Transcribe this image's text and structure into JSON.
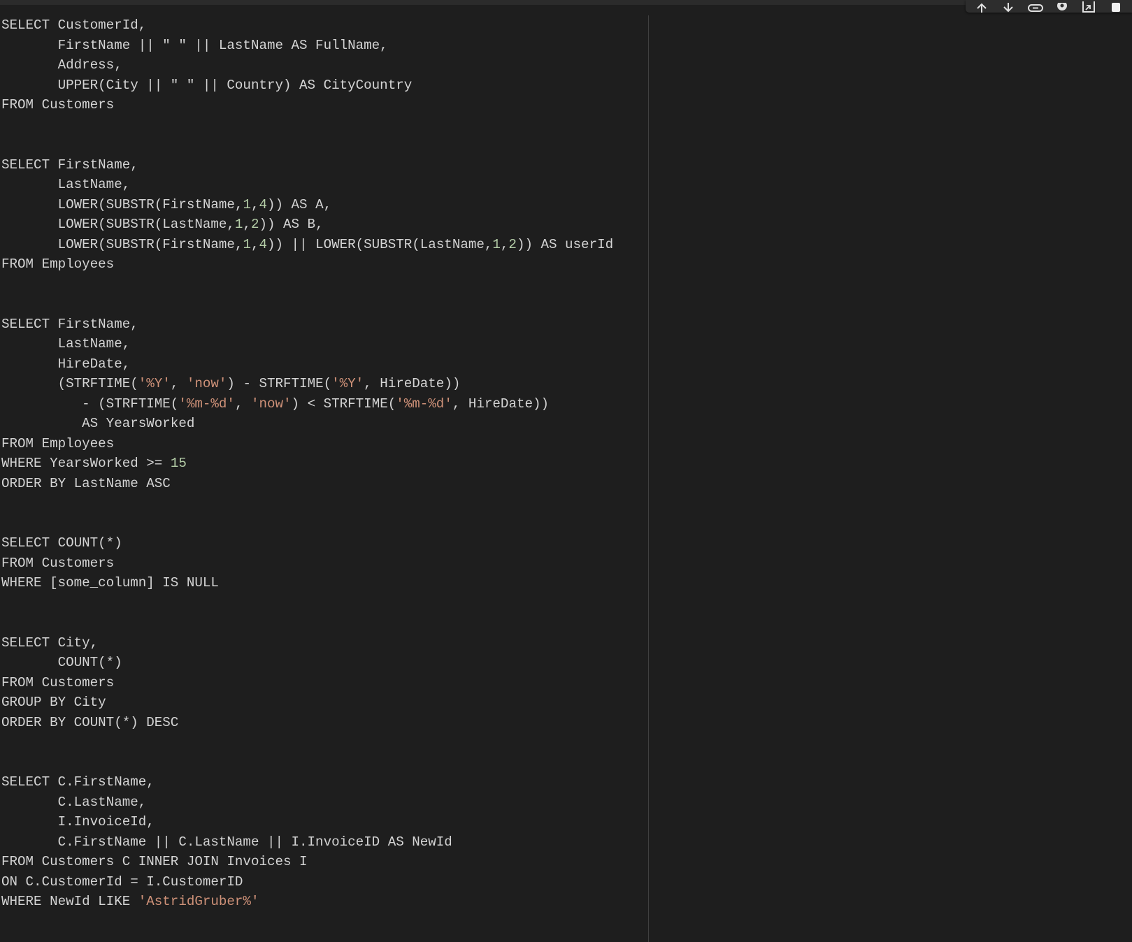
{
  "toolbar": {
    "icons": [
      "arrow-up-icon",
      "arrow-down-icon",
      "link-icon",
      "gear-icon",
      "open-external-icon",
      "trash-icon"
    ]
  },
  "colors": {
    "background": "#1e1e1e",
    "text": "#d4d4d4",
    "string": "#ce9178",
    "number": "#b5cea8"
  },
  "code": {
    "lines": [
      [
        [
          "SELECT CustomerId,",
          "t"
        ]
      ],
      [
        [
          "       FirstName || \" \" || LastName AS FullName,",
          "t"
        ]
      ],
      [
        [
          "       Address,",
          "t"
        ]
      ],
      [
        [
          "       UPPER(City || \" \" || Country) AS CityCountry",
          "t"
        ]
      ],
      [
        [
          "FROM Customers",
          "t"
        ]
      ],
      [],
      [],
      [
        [
          "SELECT FirstName,",
          "t"
        ]
      ],
      [
        [
          "       LastName,",
          "t"
        ]
      ],
      [
        [
          "       LOWER(SUBSTR(FirstName,",
          "t"
        ],
        [
          "1",
          "n"
        ],
        [
          ",",
          "t"
        ],
        [
          "4",
          "n"
        ],
        [
          ")) AS A,",
          "t"
        ]
      ],
      [
        [
          "       LOWER(SUBSTR(LastName,",
          "t"
        ],
        [
          "1",
          "n"
        ],
        [
          ",",
          "t"
        ],
        [
          "2",
          "n"
        ],
        [
          ")) AS B,",
          "t"
        ]
      ],
      [
        [
          "       LOWER(SUBSTR(FirstName,",
          "t"
        ],
        [
          "1",
          "n"
        ],
        [
          ",",
          "t"
        ],
        [
          "4",
          "n"
        ],
        [
          ")) || LOWER(SUBSTR(LastName,",
          "t"
        ],
        [
          "1",
          "n"
        ],
        [
          ",",
          "t"
        ],
        [
          "2",
          "n"
        ],
        [
          ")) AS userId",
          "t"
        ]
      ],
      [
        [
          "FROM Employees",
          "t"
        ]
      ],
      [],
      [],
      [
        [
          "SELECT FirstName,",
          "t"
        ]
      ],
      [
        [
          "       LastName,",
          "t"
        ]
      ],
      [
        [
          "       HireDate,",
          "t"
        ]
      ],
      [
        [
          "       (STRFTIME(",
          "t"
        ],
        [
          "'%Y'",
          "s"
        ],
        [
          ", ",
          "t"
        ],
        [
          "'now'",
          "s"
        ],
        [
          ") - STRFTIME(",
          "t"
        ],
        [
          "'%Y'",
          "s"
        ],
        [
          ", HireDate))",
          "t"
        ]
      ],
      [
        [
          "          - (STRFTIME(",
          "t"
        ],
        [
          "'%m-%d'",
          "s"
        ],
        [
          ", ",
          "t"
        ],
        [
          "'now'",
          "s"
        ],
        [
          ") < STRFTIME(",
          "t"
        ],
        [
          "'%m-%d'",
          "s"
        ],
        [
          ", HireDate))",
          "t"
        ]
      ],
      [
        [
          "          AS YearsWorked",
          "t"
        ]
      ],
      [
        [
          "FROM Employees",
          "t"
        ]
      ],
      [
        [
          "WHERE YearsWorked >= ",
          "t"
        ],
        [
          "15",
          "n"
        ]
      ],
      [
        [
          "ORDER BY LastName ASC",
          "t"
        ]
      ],
      [],
      [],
      [
        [
          "SELECT COUNT(*)",
          "t"
        ]
      ],
      [
        [
          "FROM Customers",
          "t"
        ]
      ],
      [
        [
          "WHERE [some_column] IS NULL",
          "t"
        ]
      ],
      [],
      [],
      [
        [
          "SELECT City,",
          "t"
        ]
      ],
      [
        [
          "       COUNT(*)",
          "t"
        ]
      ],
      [
        [
          "FROM Customers",
          "t"
        ]
      ],
      [
        [
          "GROUP BY City",
          "t"
        ]
      ],
      [
        [
          "ORDER BY COUNT(*) DESC",
          "t"
        ]
      ],
      [],
      [],
      [
        [
          "SELECT C.FirstName,",
          "t"
        ]
      ],
      [
        [
          "       C.LastName,",
          "t"
        ]
      ],
      [
        [
          "       I.InvoiceId,",
          "t"
        ]
      ],
      [
        [
          "       C.FirstName || C.LastName || I.InvoiceID AS NewId",
          "t"
        ]
      ],
      [
        [
          "FROM Customers C INNER JOIN Invoices I",
          "t"
        ]
      ],
      [
        [
          "ON C.CustomerId = I.CustomerID",
          "t"
        ]
      ],
      [
        [
          "WHERE NewId LIKE ",
          "t"
        ],
        [
          "'AstridGruber%'",
          "s"
        ]
      ]
    ]
  }
}
